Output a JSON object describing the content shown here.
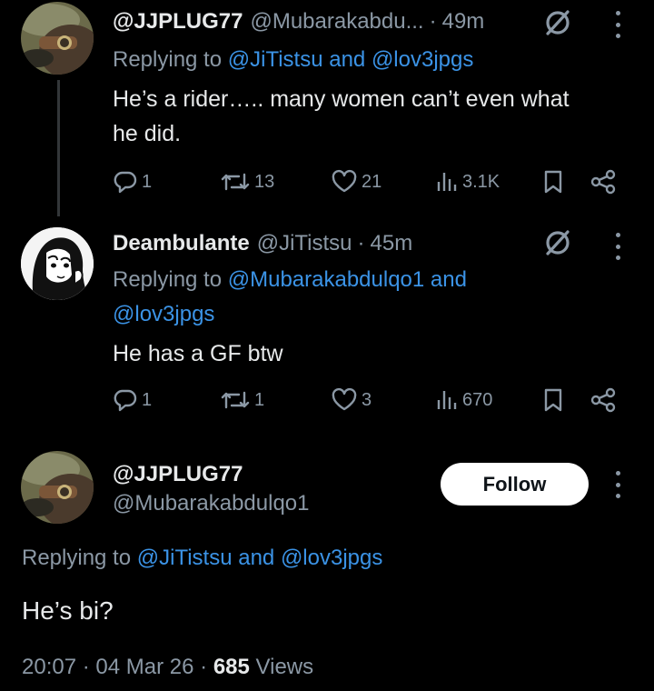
{
  "tweet1": {
    "display_name": "@JJPLUG77",
    "handle": "@Mubarakabdu...",
    "time": "49m",
    "reply_prefix": "Replying to ",
    "reply_mentions": "@JiTistsu and @lov3jpgs",
    "text_line1": "He’s a rider….. many women can’t even what",
    "text_line2": "he did.",
    "replies": "1",
    "reposts": "13",
    "likes": "21",
    "views": "3.1K"
  },
  "tweet2": {
    "display_name": "Deambulante",
    "handle": "@JiTistsu",
    "time": "45m",
    "reply_prefix": "Replying to ",
    "reply_mention_line1": "@Mubarakabdulqo1 and",
    "reply_mention_line2": "@lov3jpgs",
    "text": "He has a GF btw",
    "replies": "1",
    "reposts": "1",
    "likes": "3",
    "views": "670"
  },
  "main_tweet": {
    "display_name": "@JJPLUG77",
    "handle": "@Mubarakabdulqo1",
    "follow_label": "Follow",
    "reply_prefix": "Replying to ",
    "reply_mentions": "@JiTistsu and @lov3jpgs",
    "text": "He’s bi?",
    "time": "20:07",
    "date": "04 Mar 26",
    "views_count": "685",
    "views_label": "Views"
  },
  "separator": "·",
  "icons": [
    "grok-icon",
    "more-icon",
    "reply-icon",
    "repost-icon",
    "like-icon",
    "views-icon",
    "bookmark-icon",
    "share-icon"
  ],
  "colors": {
    "background": "#000000",
    "text": "#e7e9ea",
    "muted": "#8b98a5",
    "link": "#3b93e6",
    "follow_bg": "#ffffff"
  }
}
